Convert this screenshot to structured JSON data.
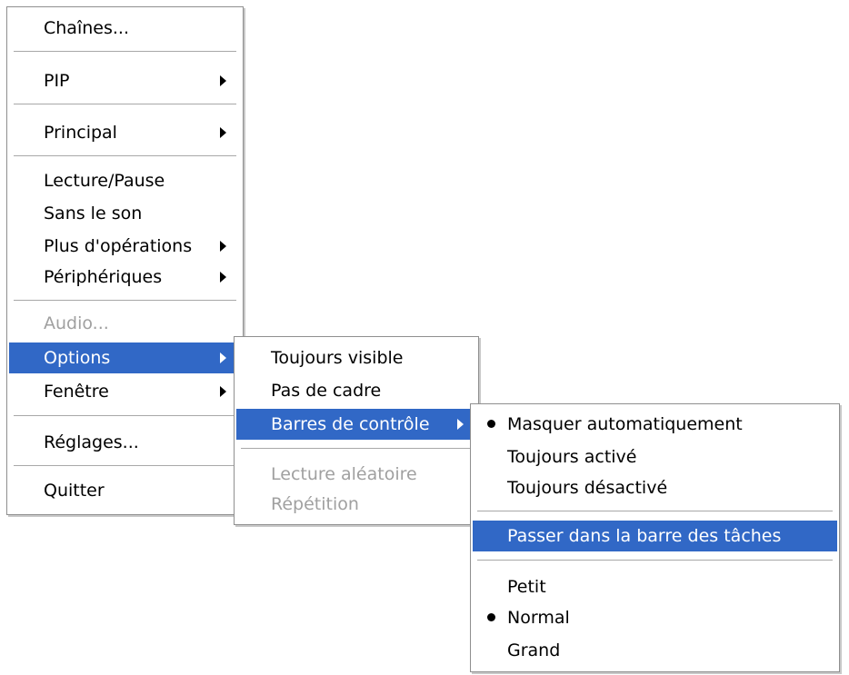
{
  "main_menu": {
    "items": [
      {
        "label": "Chaînes..."
      },
      {
        "label": "PIP"
      },
      {
        "label": "Principal"
      },
      {
        "label": "Lecture/Pause"
      },
      {
        "label": "Sans le son"
      },
      {
        "label": "Plus d'opérations"
      },
      {
        "label": "Périphériques"
      },
      {
        "label": "Audio..."
      },
      {
        "label": "Options"
      },
      {
        "label": "Fenêtre"
      },
      {
        "label": "Réglages..."
      },
      {
        "label": "Quitter"
      }
    ]
  },
  "options_menu": {
    "items": [
      {
        "label": "Toujours visible"
      },
      {
        "label": "Pas de cadre"
      },
      {
        "label": "Barres de contrôle"
      },
      {
        "label": "Lecture aléatoire"
      },
      {
        "label": "Répétition"
      }
    ]
  },
  "control_bars_menu": {
    "items": [
      {
        "label": "Masquer automatiquement"
      },
      {
        "label": "Toujours activé"
      },
      {
        "label": "Toujours désactivé"
      },
      {
        "label": "Passer dans la barre des tâches"
      },
      {
        "label": "Petit"
      },
      {
        "label": "Normal"
      },
      {
        "label": "Grand"
      }
    ]
  },
  "colors": {
    "highlight": "#3168c6",
    "disabled_text": "#a0a0a0",
    "border": "#8f8f8f"
  },
  "icons": [
    "submenu-arrow-icon",
    "radio-bullet-icon"
  ]
}
